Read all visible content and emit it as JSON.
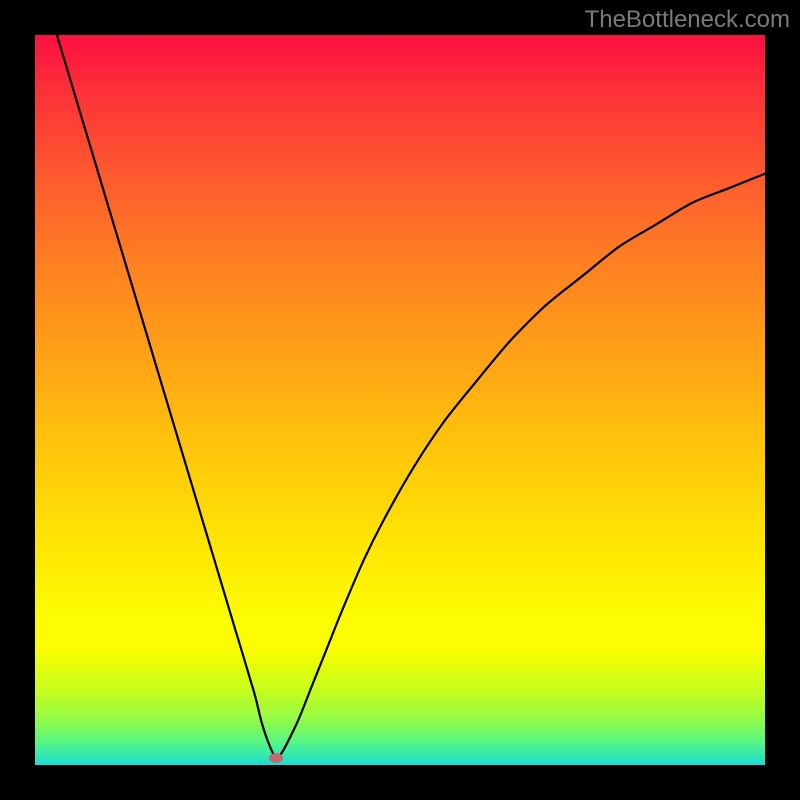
{
  "watermark": "TheBottleneck.com",
  "chart_data": {
    "type": "line",
    "title": "",
    "xlabel": "",
    "ylabel": "",
    "xlim": [
      0,
      100
    ],
    "ylim": [
      0,
      100
    ],
    "grid": false,
    "series": [
      {
        "name": "bottleneck-curve",
        "x": [
          3,
          6,
          9,
          12,
          15,
          18,
          21,
          24,
          27,
          30,
          31,
          32,
          33,
          34,
          36,
          38,
          40,
          42,
          45,
          48,
          52,
          56,
          60,
          65,
          70,
          75,
          80,
          85,
          90,
          95,
          100
        ],
        "values": [
          100,
          90,
          80,
          70,
          60,
          50,
          40,
          30,
          20,
          10,
          6,
          3,
          1,
          2,
          6,
          11,
          16,
          21,
          28,
          34,
          41,
          47,
          52,
          58,
          63,
          67,
          71,
          74,
          77,
          79,
          81
        ]
      }
    ],
    "marker": {
      "x": 33,
      "y": 1
    },
    "gradient_stops": [
      {
        "pos": 0,
        "color": "#fd1040"
      },
      {
        "pos": 8,
        "color": "#fd3238"
      },
      {
        "pos": 20,
        "color": "#fe5c2e"
      },
      {
        "pos": 32,
        "color": "#ff8221"
      },
      {
        "pos": 44,
        "color": "#ffa216"
      },
      {
        "pos": 56,
        "color": "#ffc40c"
      },
      {
        "pos": 68,
        "color": "#ffe104"
      },
      {
        "pos": 80,
        "color": "#fcfd00"
      },
      {
        "pos": 86,
        "color": "#e9fe07"
      },
      {
        "pos": 90,
        "color": "#c3fd1e"
      },
      {
        "pos": 94,
        "color": "#8efb4a"
      },
      {
        "pos": 97,
        "color": "#53f588"
      },
      {
        "pos": 99,
        "color": "#2ee6ba"
      },
      {
        "pos": 100,
        "color": "#1ed9d6"
      }
    ]
  }
}
